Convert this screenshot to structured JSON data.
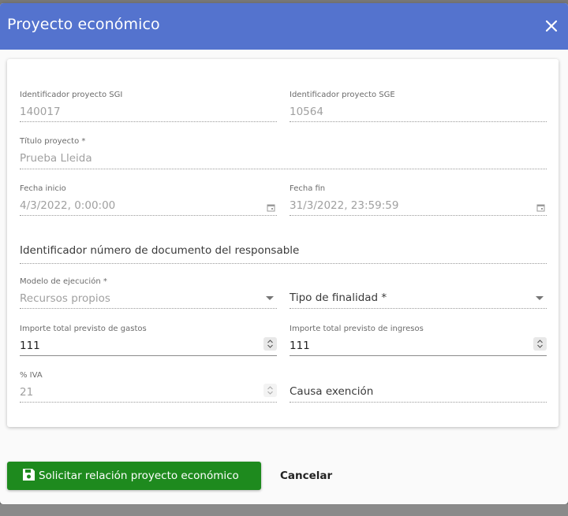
{
  "dialog": {
    "title": "Proyecto económico",
    "close_icon": "close-icon"
  },
  "form": {
    "id_sgi": {
      "label": "Identificador proyecto SGI",
      "value": "140017"
    },
    "id_sge": {
      "label": "Identificador proyecto SGE",
      "value": "10564"
    },
    "titulo": {
      "label": "Título proyecto *",
      "value": "Prueba Lleida"
    },
    "fecha_inicio": {
      "label": "Fecha inicio",
      "value": "4/3/2022, 0:00:00",
      "icon": "calendar-icon"
    },
    "fecha_fin": {
      "label": "Fecha fin",
      "value": "31/3/2022, 23:59:59",
      "icon": "calendar-icon"
    },
    "id_documento_responsable": {
      "placeholder": "Identificador número de documento del responsable"
    },
    "modelo_ejecucion": {
      "label": "Modelo de ejecución *",
      "value": "Recursos propios"
    },
    "tipo_finalidad": {
      "placeholder": "Tipo de finalidad *"
    },
    "importe_gastos": {
      "label": "Importe total previsto de gastos",
      "value": "111"
    },
    "importe_ingresos": {
      "label": "Importe total previsto de ingresos",
      "value": "111"
    },
    "iva": {
      "label": "% IVA",
      "value": "21"
    },
    "causa_exencion": {
      "placeholder": "Causa exención"
    }
  },
  "actions": {
    "submit_label": "Solicitar relación proyecto económico",
    "submit_icon": "save-icon",
    "cancel_label": "Cancelar"
  },
  "colors": {
    "header": "#5473ce",
    "submit": "#1e8a1e"
  }
}
